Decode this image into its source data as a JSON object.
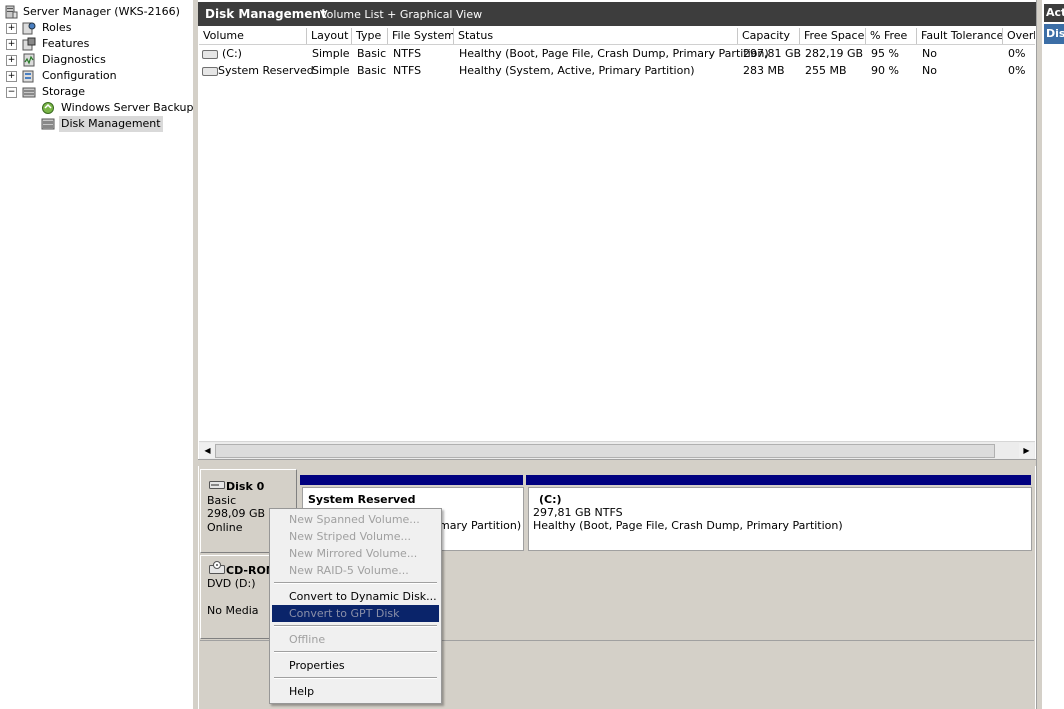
{
  "tree": {
    "root": "Server Manager (WKS-2166)",
    "items": [
      {
        "label": "Roles",
        "expander": "+"
      },
      {
        "label": "Features",
        "expander": "+"
      },
      {
        "label": "Diagnostics",
        "expander": "+"
      },
      {
        "label": "Configuration",
        "expander": "+"
      },
      {
        "label": "Storage",
        "expander": "−"
      },
      {
        "label": "Windows Server Backup"
      },
      {
        "label": "Disk Management"
      }
    ]
  },
  "main": {
    "title": "Disk Management",
    "subtitle": "Volume List + Graphical View"
  },
  "table": {
    "columns": [
      "Volume",
      "Layout",
      "Type",
      "File System",
      "Status",
      "Capacity",
      "Free Space",
      "% Free",
      "Fault Tolerance",
      "Overh"
    ],
    "rows": [
      [
        "(C:)",
        "Simple",
        "Basic",
        "NTFS",
        "Healthy (Boot, Page File, Crash Dump, Primary Partition)",
        "297,81 GB",
        "282,19 GB",
        "95 %",
        "No",
        "0%"
      ],
      [
        "System Reserved",
        "Simple",
        "Basic",
        "NTFS",
        "Healthy (System, Active, Primary Partition)",
        "283 MB",
        "255 MB",
        "90 %",
        "No",
        "0%"
      ]
    ]
  },
  "scrollbar": {
    "left": "◀",
    "right": "▶"
  },
  "disks": {
    "disk0": {
      "name": "Disk 0",
      "type": "Basic",
      "size": "298,09 GB",
      "state": "Online"
    },
    "cdrom": {
      "name": "CD-ROM",
      "type": "DVD (D:)",
      "state": "No Media"
    }
  },
  "partitions": {
    "sysres": {
      "title": "System Reserved",
      "status": "mary Partition)"
    },
    "c": {
      "title": "(C:)",
      "size": "297,81 GB NTFS",
      "status": "Healthy (Boot, Page File, Crash Dump, Primary Partition)"
    }
  },
  "rightPanel": {
    "header": "Acti",
    "item": "Disk"
  },
  "contextMenu": {
    "items": [
      "New Spanned Volume...",
      "New Striped Volume...",
      "New Mirrored Volume...",
      "New RAID-5 Volume...",
      "Convert to Dynamic Disk...",
      "Convert to GPT Disk",
      "Offline",
      "Properties",
      "Help"
    ]
  },
  "colors": {
    "header": "#3d3d3d",
    "partitionBar": "#00007f",
    "menuHighlight": "#0a246a"
  }
}
